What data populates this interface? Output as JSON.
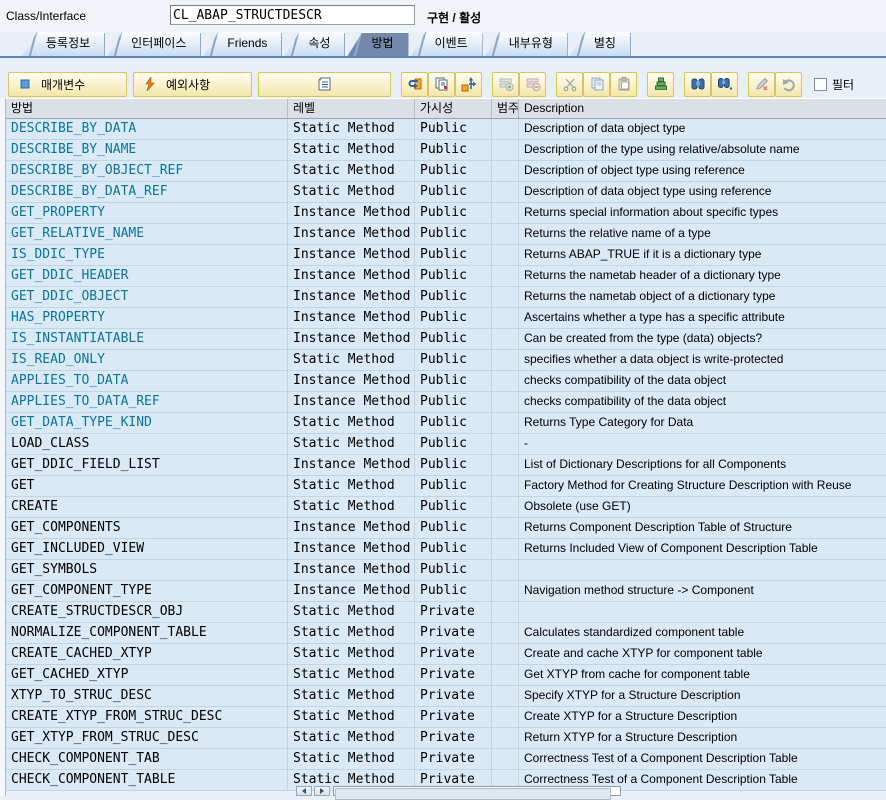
{
  "header": {
    "label": "Class/Interface",
    "class_name": "CL_ABAP_STRUCTDESCR",
    "status": "구현 / 활성"
  },
  "tabs": [
    {
      "label": "등록정보",
      "active": false
    },
    {
      "label": "인터페이스",
      "active": false
    },
    {
      "label": "Friends",
      "active": false
    },
    {
      "label": "속성",
      "active": false
    },
    {
      "label": "방법",
      "active": true
    },
    {
      "label": "이벤트",
      "active": false
    },
    {
      "label": "내부유형",
      "active": false
    },
    {
      "label": "별칭",
      "active": false
    }
  ],
  "toolbar": {
    "parameters_label": "매개변수",
    "exceptions_label": "예외사항",
    "filter_label": "필터",
    "icons": [
      "parameter-icon",
      "exception-icon",
      "detail-view-icon",
      "sync-icon",
      "copy-view-icon",
      "move-icon",
      "insert-row-icon",
      "delete-row-icon",
      "cut-icon",
      "copy-icon",
      "paste-icon",
      "sort-icon",
      "find-icon",
      "find-next-icon",
      "edit-icon",
      "undo-icon"
    ]
  },
  "colors": {
    "accent_link": "#0A7599",
    "active_tab": "#7289AB",
    "row_bg": "#D9E9F6",
    "toolbar_button": "#F5E8AC",
    "tab_line": "#5E87B5"
  },
  "table": {
    "columns": [
      "방법",
      "레벨",
      "가시성",
      "범주",
      "Description"
    ],
    "rows": [
      {
        "method": "DESCRIBE_BY_DATA",
        "level": "Static Method",
        "visibility": "Public",
        "category": "",
        "description": "Description of data object type",
        "inherited": true
      },
      {
        "method": "DESCRIBE_BY_NAME",
        "level": "Static Method",
        "visibility": "Public",
        "category": "",
        "description": "Description of the type using relative/absolute name",
        "inherited": true
      },
      {
        "method": "DESCRIBE_BY_OBJECT_REF",
        "level": "Static Method",
        "visibility": "Public",
        "category": "",
        "description": "Description of object type using reference",
        "inherited": true
      },
      {
        "method": "DESCRIBE_BY_DATA_REF",
        "level": "Static Method",
        "visibility": "Public",
        "category": "",
        "description": "Description of data object type using reference",
        "inherited": true
      },
      {
        "method": "GET_PROPERTY",
        "level": "Instance Method",
        "visibility": "Public",
        "category": "",
        "description": "Returns special information about specific types",
        "inherited": true
      },
      {
        "method": "GET_RELATIVE_NAME",
        "level": "Instance Method",
        "visibility": "Public",
        "category": "",
        "description": "Returns the relative name of a type",
        "inherited": true
      },
      {
        "method": "IS_DDIC_TYPE",
        "level": "Instance Method",
        "visibility": "Public",
        "category": "",
        "description": "Returns ABAP_TRUE if it is a dictionary type",
        "inherited": true
      },
      {
        "method": "GET_DDIC_HEADER",
        "level": "Instance Method",
        "visibility": "Public",
        "category": "",
        "description": "Returns the nametab header of a dictionary type",
        "inherited": true
      },
      {
        "method": "GET_DDIC_OBJECT",
        "level": "Instance Method",
        "visibility": "Public",
        "category": "",
        "description": "Returns the nametab object of a dictionary type",
        "inherited": true
      },
      {
        "method": "HAS_PROPERTY",
        "level": "Instance Method",
        "visibility": "Public",
        "category": "",
        "description": "Ascertains whether a type has a specific attribute",
        "inherited": true
      },
      {
        "method": "IS_INSTANTIATABLE",
        "level": "Instance Method",
        "visibility": "Public",
        "category": "",
        "description": "Can be created from the type (data) objects?",
        "inherited": true
      },
      {
        "method": "IS_READ_ONLY",
        "level": "Static Method",
        "visibility": "Public",
        "category": "",
        "description": "specifies whether a data object is write-protected",
        "inherited": true
      },
      {
        "method": "APPLIES_TO_DATA",
        "level": "Instance Method",
        "visibility": "Public",
        "category": "",
        "description": "checks compatibility of the data object",
        "inherited": true
      },
      {
        "method": "APPLIES_TO_DATA_REF",
        "level": "Instance Method",
        "visibility": "Public",
        "category": "",
        "description": "checks compatibility of the data object",
        "inherited": true
      },
      {
        "method": "GET_DATA_TYPE_KIND",
        "level": "Static Method",
        "visibility": "Public",
        "category": "",
        "description": "Returns Type Category for Data",
        "inherited": true
      },
      {
        "method": "LOAD_CLASS",
        "level": "Static Method",
        "visibility": "Public",
        "category": "",
        "description": "-",
        "inherited": false
      },
      {
        "method": "GET_DDIC_FIELD_LIST",
        "level": "Instance Method",
        "visibility": "Public",
        "category": "",
        "description": "List of Dictionary Descriptions for all Components",
        "inherited": false
      },
      {
        "method": "GET",
        "level": "Static Method",
        "visibility": "Public",
        "category": "",
        "description": "Factory Method for Creating Structure Description with Reuse",
        "inherited": false
      },
      {
        "method": "CREATE",
        "level": "Static Method",
        "visibility": "Public",
        "category": "",
        "description": "Obsolete (use GET)",
        "inherited": false
      },
      {
        "method": "GET_COMPONENTS",
        "level": "Instance Method",
        "visibility": "Public",
        "category": "",
        "description": "Returns Component Description Table of Structure",
        "inherited": false
      },
      {
        "method": "GET_INCLUDED_VIEW",
        "level": "Instance Method",
        "visibility": "Public",
        "category": "",
        "description": "Returns Included View of Component Description Table",
        "inherited": false
      },
      {
        "method": "GET_SYMBOLS",
        "level": "Instance Method",
        "visibility": "Public",
        "category": "",
        "description": "",
        "inherited": false
      },
      {
        "method": "GET_COMPONENT_TYPE",
        "level": "Instance Method",
        "visibility": "Public",
        "category": "",
        "description": "Navigation method structure -> Component",
        "inherited": false
      },
      {
        "method": "CREATE_STRUCTDESCR_OBJ",
        "level": "Static Method",
        "visibility": "Private",
        "category": "",
        "description": "",
        "inherited": false
      },
      {
        "method": "NORMALIZE_COMPONENT_TABLE",
        "level": "Static Method",
        "visibility": "Private",
        "category": "",
        "description": "Calculates standardized component table",
        "inherited": false
      },
      {
        "method": "CREATE_CACHED_XTYP",
        "level": "Static Method",
        "visibility": "Private",
        "category": "",
        "description": "Create and cache XTYP for component table",
        "inherited": false
      },
      {
        "method": "GET_CACHED_XTYP",
        "level": "Static Method",
        "visibility": "Private",
        "category": "",
        "description": "Get XTYP from cache for component table",
        "inherited": false
      },
      {
        "method": "XTYP_TO_STRUC_DESC",
        "level": "Static Method",
        "visibility": "Private",
        "category": "",
        "description": "Specify XTYP for a Structure Description",
        "inherited": false
      },
      {
        "method": "CREATE_XTYP_FROM_STRUC_DESC",
        "level": "Static Method",
        "visibility": "Private",
        "category": "",
        "description": "Create XTYP for a Structure Description",
        "inherited": false
      },
      {
        "method": "GET_XTYP_FROM_STRUC_DESC",
        "level": "Static Method",
        "visibility": "Private",
        "category": "",
        "description": "Return XTYP for a Structure Description",
        "inherited": false
      },
      {
        "method": "CHECK_COMPONENT_TAB",
        "level": "Static Method",
        "visibility": "Private",
        "category": "",
        "description": "Correctness Test of a Component Description Table",
        "inherited": false
      },
      {
        "method": "CHECK_COMPONENT_TABLE",
        "level": "Static Method",
        "visibility": "Private",
        "category": "",
        "description": "Correctness Test of a Component Description Table",
        "inherited": false
      }
    ]
  }
}
